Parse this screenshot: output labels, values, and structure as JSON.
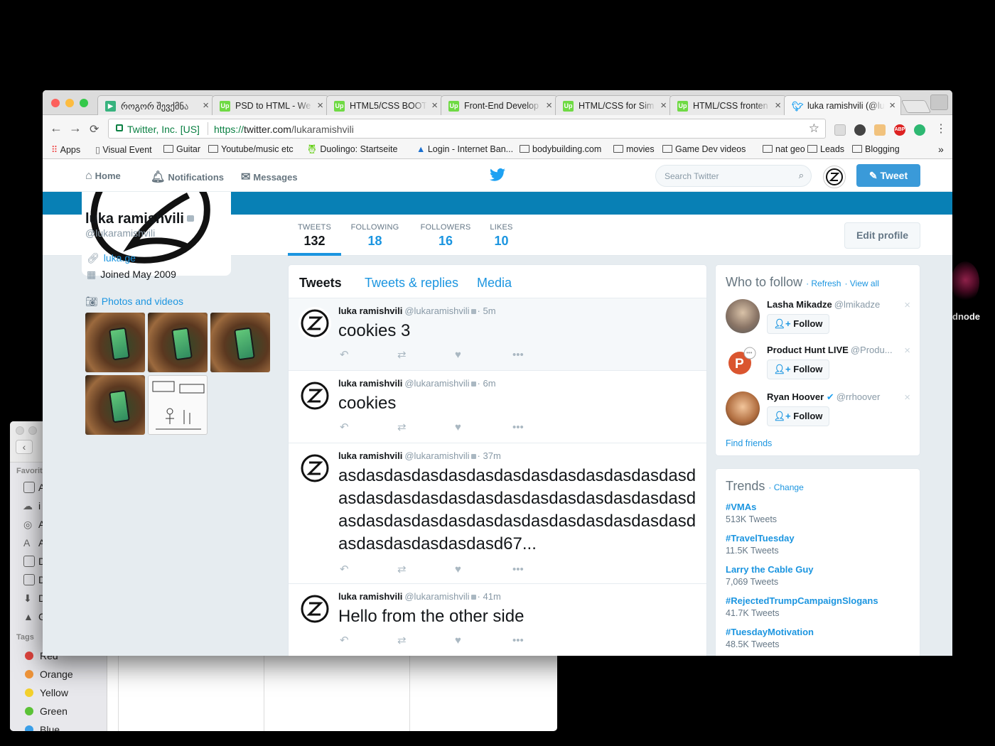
{
  "background_window": {
    "sidebar_header_favorites": "Favorit",
    "sidebar_header_tags": "Tags",
    "favorite_initials": [
      "A",
      "i",
      "A",
      "A",
      "D",
      "D",
      "D",
      "G"
    ],
    "tags": [
      {
        "label": "Red",
        "color": "#e0443e"
      },
      {
        "label": "Orange",
        "color": "#f0953a"
      },
      {
        "label": "Yellow",
        "color": "#f3d02c"
      },
      {
        "label": "Green",
        "color": "#5bc236"
      },
      {
        "label": "Blue",
        "color": "#3b9fe8"
      }
    ],
    "side_text": "dnode"
  },
  "browser": {
    "tabs": [
      {
        "title": "როგორ შევქმნა",
        "favicon": "video",
        "fav_color": "#37b37e"
      },
      {
        "title": "PSD to HTML - We",
        "favicon": "Up",
        "fav_color": "#6fda44"
      },
      {
        "title": "HTML5/CSS BOOT",
        "favicon": "Up",
        "fav_color": "#6fda44"
      },
      {
        "title": "Front-End Develop",
        "favicon": "Up",
        "fav_color": "#6fda44"
      },
      {
        "title": "HTML/CSS for Sim",
        "favicon": "Up",
        "fav_color": "#6fda44"
      },
      {
        "title": "HTML/CSS fronten",
        "favicon": "Up",
        "fav_color": "#6fda44"
      },
      {
        "title": "luka ramishvili (@lu",
        "favicon": "twitter",
        "fav_color": "#1da1f2",
        "active": true
      }
    ],
    "nav_back": "←",
    "nav_forward": "→",
    "nav_reload": "C",
    "address": {
      "org": "Twitter, Inc. [US]",
      "scheme": "https://",
      "host": "twitter.com",
      "path": "/lukaramishvili"
    },
    "star": "☆",
    "extensions": [
      "ABP"
    ],
    "menu": "⋮",
    "bookmarks": [
      "Apps",
      "Visual Event",
      "Guitar",
      "Youtube/music etc",
      "Duolingo: Startseite",
      "Login - Internet Ban...",
      "bodybuilding.com",
      "movies",
      "Game Dev videos",
      "nat geo",
      "Leads",
      "Blogging"
    ],
    "bookmarks_more": "»"
  },
  "twitter": {
    "nav": {
      "home": "Home",
      "notifications": "Notifications",
      "messages": "Messages",
      "search_placeholder": "Search Twitter",
      "tweet_button": "Tweet"
    },
    "stats": [
      {
        "label": "TWEETS",
        "value": "132"
      },
      {
        "label": "FOLLOWING",
        "value": "18"
      },
      {
        "label": "FOLLOWERS",
        "value": "16"
      },
      {
        "label": "LIKES",
        "value": "10"
      }
    ],
    "edit_profile": "Edit profile",
    "profile": {
      "name": "luka ramishvili",
      "handle": "@lukaramishvili",
      "link": "luka.ge",
      "joined": "Joined May 2009",
      "photos_label": "Photos and videos"
    },
    "timeline_tabs": [
      "Tweets",
      "Tweets & replies",
      "Media"
    ],
    "tweets": [
      {
        "name": "luka ramishvili",
        "handle": "@lukaramishvili",
        "time": "· 5m",
        "text": "cookies 3"
      },
      {
        "name": "luka ramishvili",
        "handle": "@lukaramishvili",
        "time": "· 6m",
        "text": "cookies"
      },
      {
        "name": "luka ramishvili",
        "handle": "@lukaramishvili",
        "time": "· 37m",
        "text": "asdasdasdasdasdasdasdasdasdasdasdasdasdasdasdasdasdasdasdasdasdasdasdasdasdasdasdasdasdasdasdasdasdasdasdasdasdasdasdasdasdasdasdasdasd67..."
      },
      {
        "name": "luka ramishvili",
        "handle": "@lukaramishvili",
        "time": "· 41m",
        "text": "Hello from the other side"
      }
    ],
    "who_to_follow": {
      "title": "Who to follow",
      "refresh": "· Refresh",
      "view_all": "· View all",
      "users": [
        {
          "name": "Lasha Mikadze",
          "handle": "@lmikadze",
          "follow": "Follow"
        },
        {
          "name": "Product Hunt LIVE",
          "handle": "@Produ...",
          "follow": "Follow"
        },
        {
          "name": "Ryan Hoover",
          "handle": "@rrhoover",
          "follow": "Follow",
          "verified": true
        }
      ],
      "find_friends": "Find friends"
    },
    "trends": {
      "title": "Trends",
      "change": "· Change",
      "items": [
        {
          "name": "#VMAs",
          "count": "513K Tweets"
        },
        {
          "name": "#TravelTuesday",
          "count": "11.5K Tweets"
        },
        {
          "name": "Larry the Cable Guy",
          "count": "7,069 Tweets"
        },
        {
          "name": "#RejectedTrumpCampaignSlogans",
          "count": "41.7K Tweets"
        },
        {
          "name": "#TuesdayMotivation",
          "count": "48.5K Tweets"
        }
      ]
    }
  }
}
